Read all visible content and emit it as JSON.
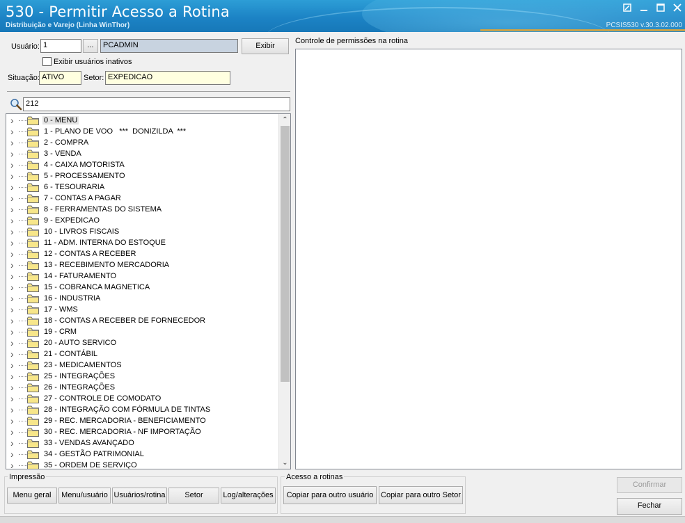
{
  "window": {
    "title": "530 - Permitir Acesso a Rotina",
    "subtitle": "Distribuição e Varejo (Linha WinThor)",
    "version": "PCSIS530  v.30.3.02.000",
    "controls": [
      "restore-icon",
      "minimize-icon",
      "maximize-icon",
      "close-icon"
    ]
  },
  "user": {
    "label": "Usuário:",
    "code": "1",
    "lookup_label": "...",
    "name": "PCADMIN",
    "show_button": "Exibir",
    "show_inactive_label": "Exibir usuários inativos",
    "status_label": "Situação:",
    "status_value": "ATIVO",
    "sector_label": "Setor:",
    "sector_value": "EXPEDICAO"
  },
  "search": {
    "icon": "search-icon",
    "value": "212"
  },
  "tree": {
    "items": [
      "0 - MENU",
      "1 - PLANO DE VOO   ***  DONIZILDA  ***",
      "2 - COMPRA",
      "3 - VENDA",
      "4 - CAIXA MOTORISTA",
      "5 - PROCESSAMENTO",
      "6 - TESOURARIA",
      "7 - CONTAS A PAGAR",
      "8 - FERRAMENTAS DO SISTEMA",
      "9 - EXPEDICAO",
      "10 - LIVROS FISCAIS",
      "11 - ADM. INTERNA DO ESTOQUE",
      "12 - CONTAS A RECEBER",
      "13 - RECEBIMENTO MERCADORIA",
      "14 - FATURAMENTO",
      "15 - COBRANCA MAGNETICA",
      "16 - INDUSTRIA",
      "17 - WMS",
      "18 - CONTAS A RECEBER DE FORNECEDOR",
      "19 - CRM",
      "20 - AUTO SERVICO",
      "21 - CONTÁBIL",
      "23 - MEDICAMENTOS",
      "25 - INTEGRAÇÕES",
      "26 - INTEGRAÇÕES",
      "27 - CONTROLE DE COMODATO",
      "28 - INTEGRAÇÃO COM FÓRMULA DE TINTAS",
      "29 - REC. MERCADORIA - BENEFICIAMENTO",
      "30 - REC. MERCADORIA - NF IMPORTAÇÃO",
      "33 - VENDAS AVANÇADO",
      "34 - GESTÃO PATRIMONIAL",
      "35 - ORDEM DE SERVIÇO"
    ]
  },
  "permissions": {
    "label": "Controle de permissões na rotina"
  },
  "print_group": {
    "title": "Impressão",
    "buttons": [
      "Menu geral",
      "Menu/usuário",
      "Usuários/rotina",
      "Setor",
      "Log/alterações"
    ]
  },
  "access_group": {
    "title": "Acesso a rotinas",
    "buttons": [
      "Copiar para outro usuário",
      "Copiar para outro Setor"
    ]
  },
  "actions": {
    "confirm": "Confirmar",
    "close": "Fechar"
  },
  "colors": {
    "titlebar": "#1c83c5",
    "readonly_field": "#c8d3e0",
    "highlight_field": "#ffffe0",
    "folder": "#f7e68a"
  }
}
